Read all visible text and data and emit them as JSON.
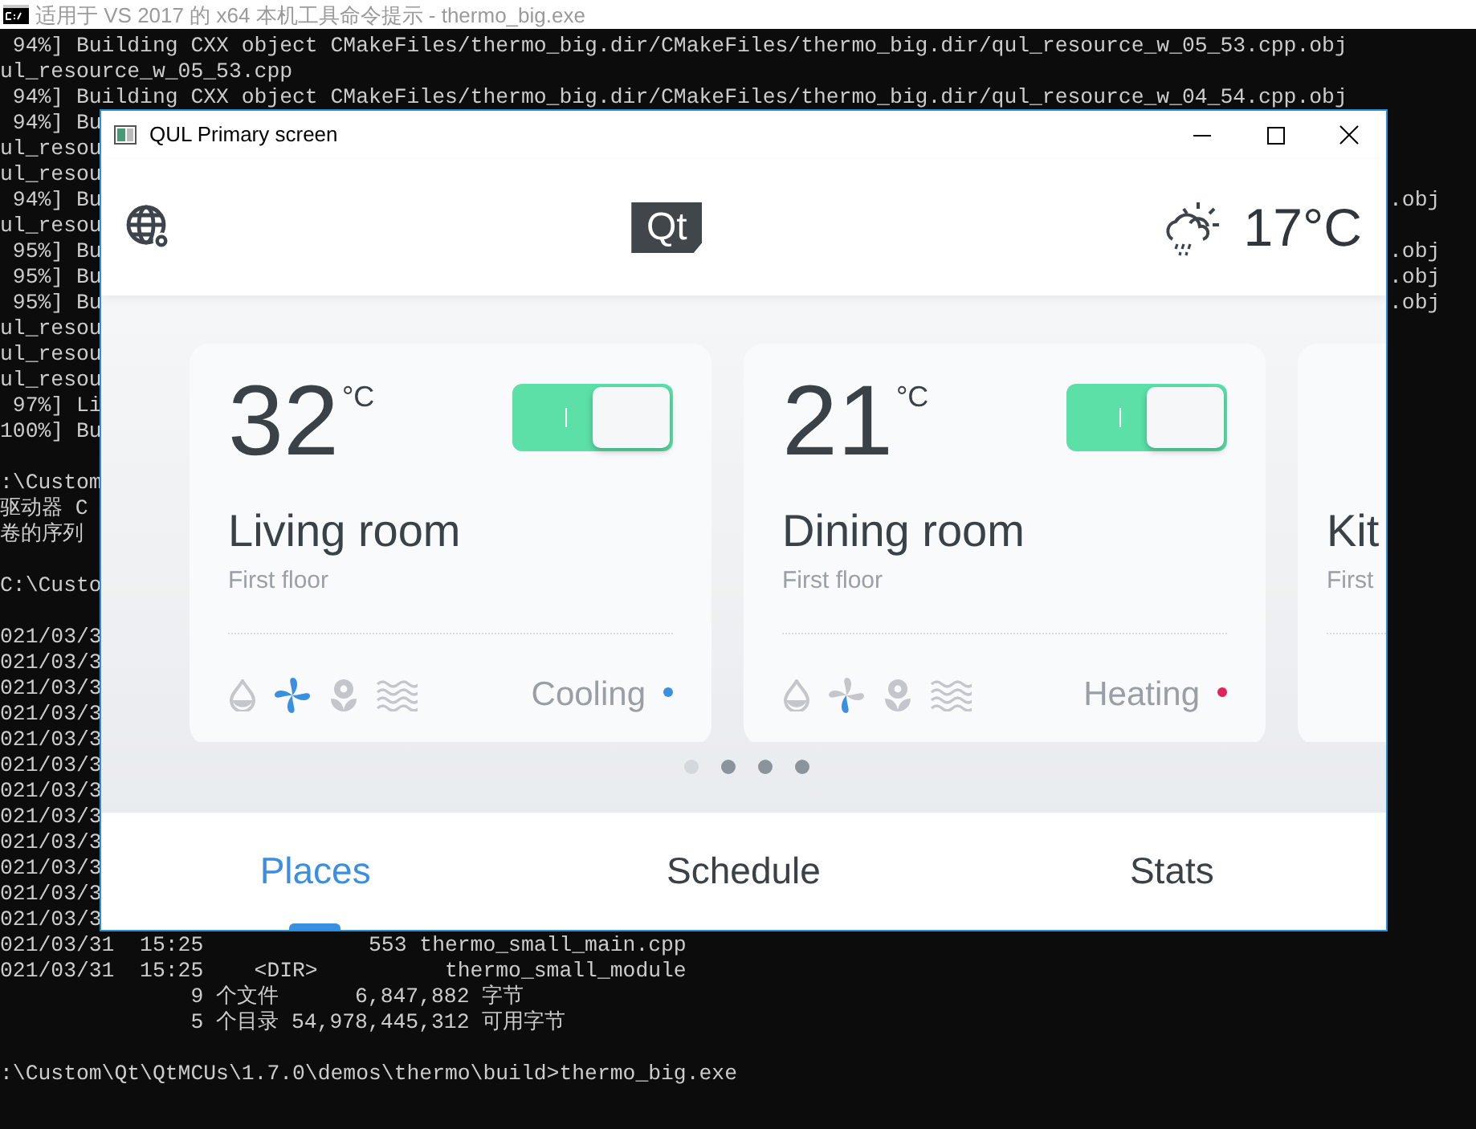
{
  "console": {
    "title": "适用于 VS 2017 的 x64 本机工具命令提示 - thermo_big.exe",
    "lines": [
      {
        "text": " 94%] Building CXX object CMakeFiles/thermo_big.dir/CMakeFiles/thermo_big.dir/qul_resource_w_05_53.cpp.obj"
      },
      {
        "text": "ul_resource_w_05_53.cpp"
      },
      {
        "text": " 94%] Building CXX object CMakeFiles/thermo_big.dir/CMakeFiles/thermo_big.dir/qul_resource_w_04_54.cpp.obj"
      },
      {
        "text": " 94%] Bu"
      },
      {
        "text": "ul_resou"
      },
      {
        "text": "ul_resou"
      },
      {
        "text": " 94%] Bu",
        "right": ".obj"
      },
      {
        "text": "ul_resou"
      },
      {
        "text": " 95%] Bu",
        "right": ".obj"
      },
      {
        "text": " 95%] Bu",
        "right": ".obj"
      },
      {
        "text": " 95%] Bu",
        "right": ".obj"
      },
      {
        "text": "ul_resou"
      },
      {
        "text": "ul_resou"
      },
      {
        "text": "ul_resou"
      },
      {
        "text": " 97%] Li"
      },
      {
        "text": "100%] Bu"
      },
      {
        "text": ":\\Custom",
        "blank_before": true
      },
      {
        "text": "驱动器 C"
      },
      {
        "text": "卷的序列"
      },
      {
        "text": "C:\\Custo",
        "blank_before": true
      },
      {
        "text": "021/03/3",
        "blank_before": true
      },
      {
        "text": "021/03/3"
      },
      {
        "text": "021/03/3"
      },
      {
        "text": "021/03/3"
      },
      {
        "text": "021/03/3"
      },
      {
        "text": "021/03/3"
      },
      {
        "text": "021/03/3"
      },
      {
        "text": "021/03/3"
      },
      {
        "text": "021/03/3"
      },
      {
        "text": "021/03/3"
      },
      {
        "text": "021/03/3"
      },
      {
        "text": "021/03/3"
      },
      {
        "text": "021/03/31  15:25             553 thermo_small_main.cpp"
      },
      {
        "text": "021/03/31  15:25    <DIR>          thermo_small_module"
      },
      {
        "text": "               9 个文件      6,847,882 字节"
      },
      {
        "text": "               5 个目录 54,978,445,312 可用字节"
      },
      {
        "text": ":\\Custom\\Qt\\QtMCUs\\1.7.0\\demos\\thermo\\build>thermo_big.exe",
        "blank_before": true
      }
    ]
  },
  "app": {
    "title": "QUL Primary screen",
    "logo": "Qt",
    "outdoor_temperature": "17°C",
    "rooms": [
      {
        "temperature": "32",
        "unit": "°C",
        "on": true,
        "name": "Living room",
        "floor": "First floor",
        "mode": "Cooling",
        "color": "#3b8fe0",
        "fan": {
          "active": true
        }
      },
      {
        "temperature": "21",
        "unit": "°C",
        "on": true,
        "name": "Dining room",
        "floor": "First floor",
        "mode": "Heating",
        "color": "#e0245e",
        "fan": {
          "active": false
        }
      },
      {
        "name": "Kit",
        "floor": "First"
      }
    ],
    "pages": [
      {
        "selected": true
      },
      {
        "selected": false
      },
      {
        "selected": false
      },
      {
        "selected": false
      }
    ],
    "tabs": [
      {
        "label": "Places",
        "selected": true
      },
      {
        "label": "Schedule",
        "selected": false
      },
      {
        "label": "Stats",
        "selected": false
      }
    ]
  }
}
